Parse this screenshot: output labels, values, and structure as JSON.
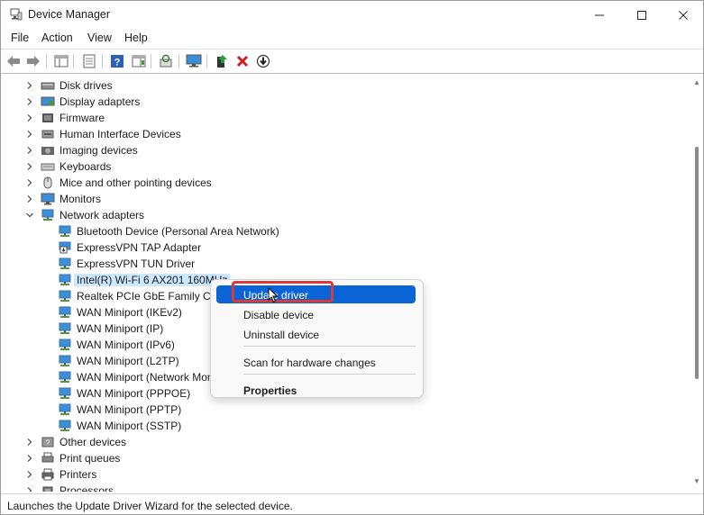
{
  "window": {
    "title": "Device Manager"
  },
  "menu": [
    "File",
    "Action",
    "View",
    "Help"
  ],
  "toolbar": {
    "buttons": [
      "back-icon",
      "forward-icon",
      "show-hide-console-tree-icon",
      "properties-icon",
      "help-icon",
      "action-pane-icon",
      "scan-hardware-icon",
      "monitor-icon",
      "update-driver-icon",
      "uninstall-icon",
      "disable-icon"
    ]
  },
  "tree": {
    "categories_top": [
      {
        "label": "Disk drives",
        "icon": "disk-drive-icon"
      },
      {
        "label": "Display adapters",
        "icon": "display-adapter-icon"
      },
      {
        "label": "Firmware",
        "icon": "firmware-icon"
      },
      {
        "label": "Human Interface Devices",
        "icon": "hid-icon"
      },
      {
        "label": "Imaging devices",
        "icon": "camera-icon"
      },
      {
        "label": "Keyboards",
        "icon": "keyboard-icon"
      },
      {
        "label": "Mice and other pointing devices",
        "icon": "mouse-icon"
      },
      {
        "label": "Monitors",
        "icon": "monitor-icon"
      }
    ],
    "network": {
      "label": "Network adapters",
      "children": [
        "Bluetooth Device (Personal Area Network)",
        "ExpressVPN TAP Adapter",
        "ExpressVPN TUN Driver",
        "Intel(R) Wi-Fi 6 AX201 160MHz",
        "Realtek PCIe GbE Family Controller",
        "WAN Miniport (IKEv2)",
        "WAN Miniport (IP)",
        "WAN Miniport (IPv6)",
        "WAN Miniport (L2TP)",
        "WAN Miniport (Network Monitor)",
        "WAN Miniport (PPPOE)",
        "WAN Miniport (PPTP)",
        "WAN Miniport (SSTP)"
      ],
      "selected_index": 3
    },
    "categories_bottom": [
      {
        "label": "Other devices",
        "icon": "other-devices-icon"
      },
      {
        "label": "Print queues",
        "icon": "print-queue-icon"
      },
      {
        "label": "Printers",
        "icon": "printer-icon"
      },
      {
        "label": "Processors",
        "icon": "processor-icon"
      }
    ]
  },
  "context_menu": {
    "items": [
      "Update driver",
      "Disable device",
      "Uninstall device",
      "Scan for hardware changes",
      "Properties"
    ],
    "highlighted": "Update driver"
  },
  "status": {
    "text": "Launches the Update Driver Wizard for the selected device."
  },
  "colors": {
    "selection": "#cce8ff",
    "menu_highlight": "#0a64d6",
    "callout": "#d93a3a"
  }
}
